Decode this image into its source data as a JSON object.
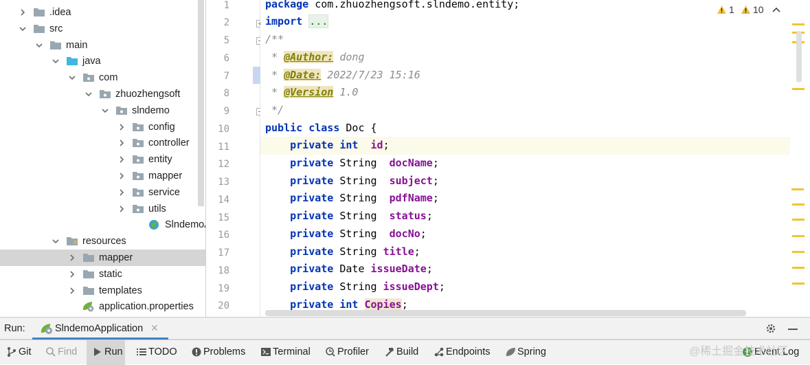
{
  "project_tree": [
    {
      "label": ".idea",
      "depth": 0,
      "expanded": false,
      "icon": "folder"
    },
    {
      "label": "src",
      "depth": 0,
      "expanded": true,
      "icon": "folder"
    },
    {
      "label": "main",
      "depth": 1,
      "expanded": true,
      "icon": "folder"
    },
    {
      "label": "java",
      "depth": 2,
      "expanded": true,
      "icon": "source-folder"
    },
    {
      "label": "com",
      "depth": 3,
      "expanded": true,
      "icon": "package"
    },
    {
      "label": "zhuozhengsoft",
      "depth": 4,
      "expanded": true,
      "icon": "package"
    },
    {
      "label": "slndemo",
      "depth": 5,
      "expanded": true,
      "icon": "package"
    },
    {
      "label": "config",
      "depth": 6,
      "expanded": false,
      "icon": "package"
    },
    {
      "label": "controller",
      "depth": 6,
      "expanded": false,
      "icon": "package"
    },
    {
      "label": "entity",
      "depth": 6,
      "expanded": false,
      "icon": "package"
    },
    {
      "label": "mapper",
      "depth": 6,
      "expanded": false,
      "icon": "package"
    },
    {
      "label": "service",
      "depth": 6,
      "expanded": false,
      "icon": "package"
    },
    {
      "label": "utils",
      "depth": 6,
      "expanded": false,
      "icon": "package"
    },
    {
      "label": "SlndemoAppl",
      "depth": 7,
      "expanded": null,
      "icon": "spring-class"
    },
    {
      "label": "resources",
      "depth": 2,
      "expanded": true,
      "icon": "resources-folder"
    },
    {
      "label": "mapper",
      "depth": 3,
      "expanded": false,
      "icon": "folder",
      "selected": true
    },
    {
      "label": "static",
      "depth": 3,
      "expanded": false,
      "icon": "folder"
    },
    {
      "label": "templates",
      "depth": 3,
      "expanded": false,
      "icon": "folder"
    },
    {
      "label": "application.properties",
      "depth": 3,
      "expanded": null,
      "icon": "properties"
    }
  ],
  "editor": {
    "line_numbers": [
      "1",
      "2",
      "5",
      "6",
      "7",
      "8",
      "9",
      "10",
      "11",
      "12",
      "13",
      "14",
      "15",
      "16",
      "17",
      "18",
      "19",
      "20"
    ],
    "inspections": {
      "warnings": "1",
      "weak_warnings": "10"
    },
    "code": {
      "l1_kw": "package",
      "l1_rest": " com.zhuozhengsoft.slndemo.entity;",
      "l2_kw": "import",
      "l2_fold": "...",
      "l5": "/**",
      "l6_star": " * ",
      "l6_tag": "@Author:",
      "l6_val": " dong",
      "l7_star": " * ",
      "l7_tag": "@Date:",
      "l7_val": " 2022/7/23 15:16",
      "l8_star": " * ",
      "l8_tag": "@Version",
      "l8_val": " 1.0",
      "l9": " */",
      "l10_kw": "public class",
      "l10_cls": " Doc {",
      "fields": [
        {
          "mod": "private",
          "type_kw": "int",
          "type": "",
          "sep": "  ",
          "name": "id"
        },
        {
          "mod": "private",
          "type_kw": "",
          "type": "String",
          "sep": "  ",
          "name": "docName"
        },
        {
          "mod": "private",
          "type_kw": "",
          "type": "String",
          "sep": "  ",
          "name": "subject"
        },
        {
          "mod": "private",
          "type_kw": "",
          "type": "String",
          "sep": "  ",
          "name": "pdfName"
        },
        {
          "mod": "private",
          "type_kw": "",
          "type": "String",
          "sep": "  ",
          "name": "status"
        },
        {
          "mod": "private",
          "type_kw": "",
          "type": "String",
          "sep": "  ",
          "name": "docNo"
        },
        {
          "mod": "private",
          "type_kw": "",
          "type": "String",
          "sep": " ",
          "name": "title"
        },
        {
          "mod": "private",
          "type_kw": "",
          "type": "Date",
          "sep": " ",
          "name": "issueDate"
        },
        {
          "mod": "private",
          "type_kw": "",
          "type": "String",
          "sep": " ",
          "name": "issueDept"
        },
        {
          "mod": "private",
          "type_kw": "int",
          "type": "",
          "sep": " ",
          "name": "Copies"
        }
      ]
    }
  },
  "run_bar": {
    "label": "Run:",
    "tab": "SlndemoApplication"
  },
  "toolbar": {
    "git": "Git",
    "find": "Find",
    "run": "Run",
    "todo": "TODO",
    "problems": "Problems",
    "terminal": "Terminal",
    "profiler": "Profiler",
    "build": "Build",
    "endpoints": "Endpoints",
    "spring": "Spring",
    "event_log": "Event Log"
  },
  "watermark": "@稀土掘金技术社区",
  "colors": {
    "keyword": "#0033b3",
    "field": "#871094",
    "comment": "#8c8c8c",
    "accent": "#4083c9",
    "warning": "#f2c330"
  }
}
